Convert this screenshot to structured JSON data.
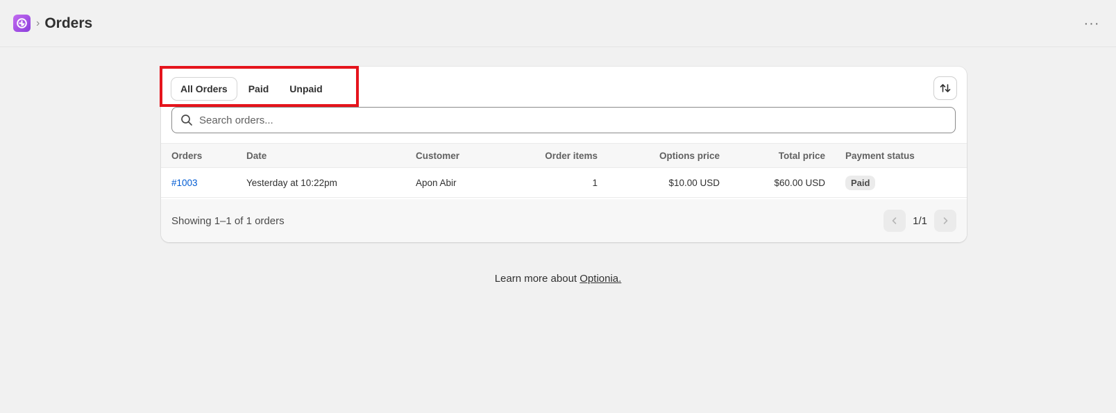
{
  "header": {
    "title": "Orders",
    "separator": "›",
    "more": "···"
  },
  "tabs": [
    {
      "label": "All Orders",
      "active": true
    },
    {
      "label": "Paid",
      "active": false
    },
    {
      "label": "Unpaid",
      "active": false
    }
  ],
  "search": {
    "placeholder": "Search orders...",
    "value": ""
  },
  "table": {
    "columns": [
      "Orders",
      "Date",
      "Customer",
      "Order items",
      "Options price",
      "Total price",
      "Payment status"
    ],
    "rows": [
      {
        "order": "#1003",
        "date": "Yesterday at 10:22pm",
        "customer": "Apon Abir",
        "items": "1",
        "options_price": "$10.00 USD",
        "total_price": "$60.00 USD",
        "payment_status": "Paid"
      }
    ]
  },
  "footer": {
    "showing": "Showing 1–1 of 1 orders",
    "page": "1/1"
  },
  "learn_more": {
    "text": "Learn more about ",
    "link": "Optionia."
  },
  "colors": {
    "highlight": "#e5141c",
    "link": "#005bd3",
    "logo": "#9b4de4"
  }
}
